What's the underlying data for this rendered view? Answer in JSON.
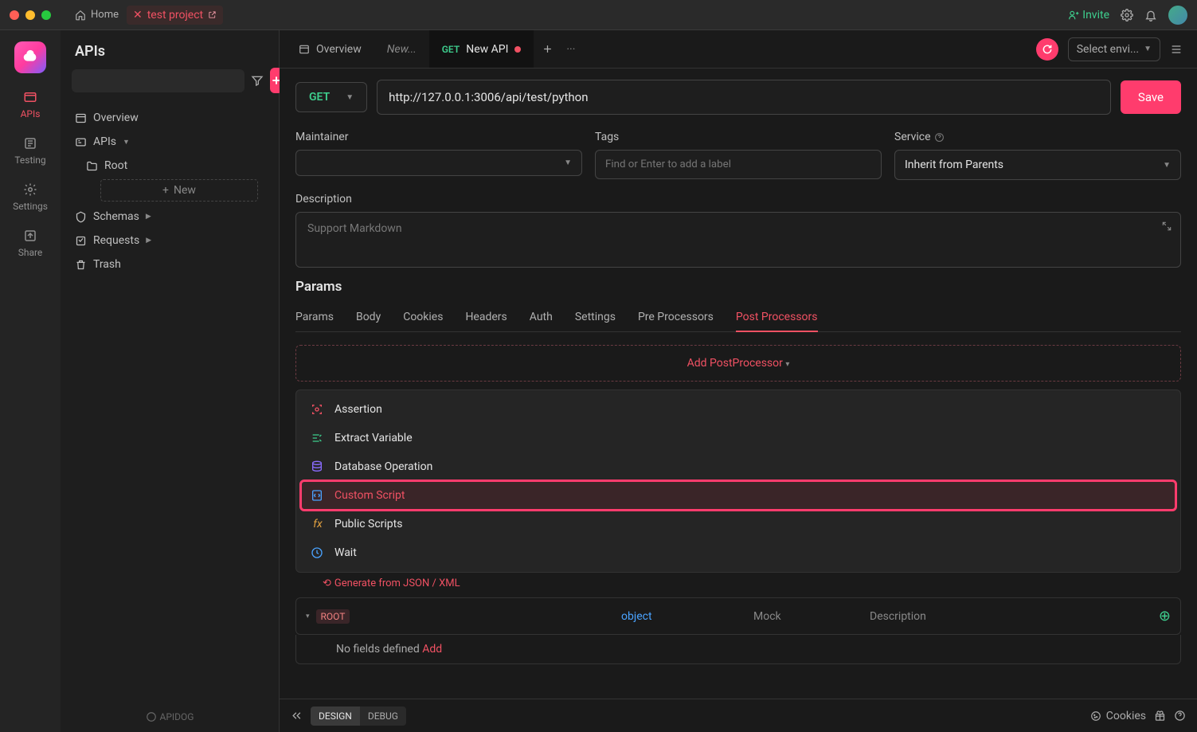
{
  "titlebar": {
    "home": "Home",
    "project_tab": "test project",
    "invite": "Invite"
  },
  "iconbar": {
    "apis": "APIs",
    "testing": "Testing",
    "settings": "Settings",
    "share": "Share"
  },
  "sidebar": {
    "title": "APIs",
    "overview": "Overview",
    "apis": "APIs",
    "root": "Root",
    "new_btn": "New",
    "schemas": "Schemas",
    "requests": "Requests",
    "trash": "Trash",
    "brand": "APIDOG"
  },
  "tabs": {
    "overview": "Overview",
    "new": "New...",
    "active_method": "GET",
    "active_title": "New API",
    "env_placeholder": "Select envi..."
  },
  "url_row": {
    "method": "GET",
    "url": "http://127.0.0.1:3006/api/test/python",
    "save": "Save"
  },
  "form": {
    "maintainer_label": "Maintainer",
    "tags_label": "Tags",
    "tags_placeholder": "Find or Enter to add a label",
    "service_label": "Service",
    "service_value": "Inherit from Parents",
    "description_label": "Description",
    "description_placeholder": "Support Markdown"
  },
  "params_section": {
    "title": "Params",
    "tabs": [
      "Params",
      "Body",
      "Cookies",
      "Headers",
      "Auth",
      "Settings",
      "Pre Processors",
      "Post Processors"
    ],
    "active_tab": "Post Processors",
    "add_label": "Add PostProcessor",
    "menu": {
      "assertion": "Assertion",
      "extract": "Extract Variable",
      "db": "Database Operation",
      "custom": "Custom Script",
      "public": "Public Scripts",
      "wait": "Wait"
    }
  },
  "behind": {
    "generate": "Generate from JSON / XML",
    "root": "ROOT",
    "type": "object",
    "mock": "Mock",
    "description": "Description",
    "no_fields": "No fields defined ",
    "add": "Add"
  },
  "footer": {
    "design": "DESIGN",
    "debug": "DEBUG",
    "cookies": "Cookies"
  }
}
